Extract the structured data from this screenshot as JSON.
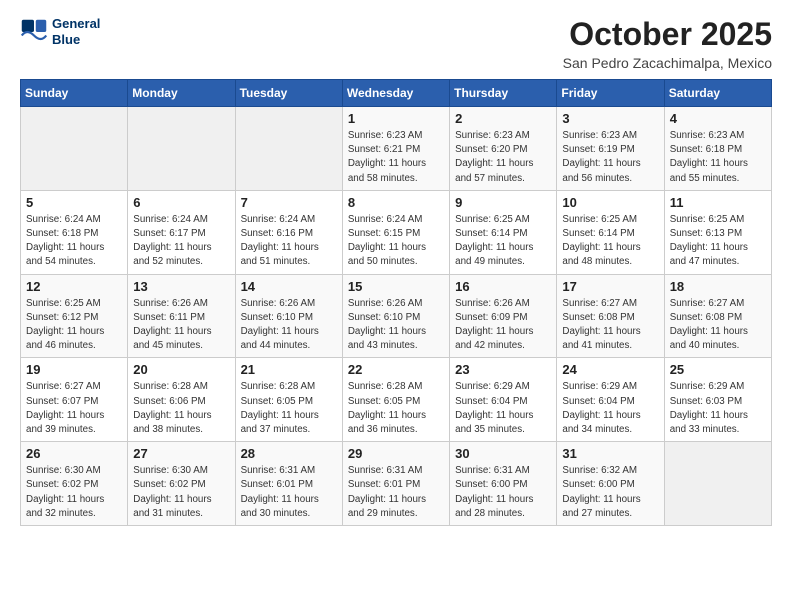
{
  "header": {
    "logo_line1": "General",
    "logo_line2": "Blue",
    "month": "October 2025",
    "location": "San Pedro Zacachimalpa, Mexico"
  },
  "weekdays": [
    "Sunday",
    "Monday",
    "Tuesday",
    "Wednesday",
    "Thursday",
    "Friday",
    "Saturday"
  ],
  "weeks": [
    [
      {
        "day": "",
        "info": ""
      },
      {
        "day": "",
        "info": ""
      },
      {
        "day": "",
        "info": ""
      },
      {
        "day": "1",
        "info": "Sunrise: 6:23 AM\nSunset: 6:21 PM\nDaylight: 11 hours\nand 58 minutes."
      },
      {
        "day": "2",
        "info": "Sunrise: 6:23 AM\nSunset: 6:20 PM\nDaylight: 11 hours\nand 57 minutes."
      },
      {
        "day": "3",
        "info": "Sunrise: 6:23 AM\nSunset: 6:19 PM\nDaylight: 11 hours\nand 56 minutes."
      },
      {
        "day": "4",
        "info": "Sunrise: 6:23 AM\nSunset: 6:18 PM\nDaylight: 11 hours\nand 55 minutes."
      }
    ],
    [
      {
        "day": "5",
        "info": "Sunrise: 6:24 AM\nSunset: 6:18 PM\nDaylight: 11 hours\nand 54 minutes."
      },
      {
        "day": "6",
        "info": "Sunrise: 6:24 AM\nSunset: 6:17 PM\nDaylight: 11 hours\nand 52 minutes."
      },
      {
        "day": "7",
        "info": "Sunrise: 6:24 AM\nSunset: 6:16 PM\nDaylight: 11 hours\nand 51 minutes."
      },
      {
        "day": "8",
        "info": "Sunrise: 6:24 AM\nSunset: 6:15 PM\nDaylight: 11 hours\nand 50 minutes."
      },
      {
        "day": "9",
        "info": "Sunrise: 6:25 AM\nSunset: 6:14 PM\nDaylight: 11 hours\nand 49 minutes."
      },
      {
        "day": "10",
        "info": "Sunrise: 6:25 AM\nSunset: 6:14 PM\nDaylight: 11 hours\nand 48 minutes."
      },
      {
        "day": "11",
        "info": "Sunrise: 6:25 AM\nSunset: 6:13 PM\nDaylight: 11 hours\nand 47 minutes."
      }
    ],
    [
      {
        "day": "12",
        "info": "Sunrise: 6:25 AM\nSunset: 6:12 PM\nDaylight: 11 hours\nand 46 minutes."
      },
      {
        "day": "13",
        "info": "Sunrise: 6:26 AM\nSunset: 6:11 PM\nDaylight: 11 hours\nand 45 minutes."
      },
      {
        "day": "14",
        "info": "Sunrise: 6:26 AM\nSunset: 6:10 PM\nDaylight: 11 hours\nand 44 minutes."
      },
      {
        "day": "15",
        "info": "Sunrise: 6:26 AM\nSunset: 6:10 PM\nDaylight: 11 hours\nand 43 minutes."
      },
      {
        "day": "16",
        "info": "Sunrise: 6:26 AM\nSunset: 6:09 PM\nDaylight: 11 hours\nand 42 minutes."
      },
      {
        "day": "17",
        "info": "Sunrise: 6:27 AM\nSunset: 6:08 PM\nDaylight: 11 hours\nand 41 minutes."
      },
      {
        "day": "18",
        "info": "Sunrise: 6:27 AM\nSunset: 6:08 PM\nDaylight: 11 hours\nand 40 minutes."
      }
    ],
    [
      {
        "day": "19",
        "info": "Sunrise: 6:27 AM\nSunset: 6:07 PM\nDaylight: 11 hours\nand 39 minutes."
      },
      {
        "day": "20",
        "info": "Sunrise: 6:28 AM\nSunset: 6:06 PM\nDaylight: 11 hours\nand 38 minutes."
      },
      {
        "day": "21",
        "info": "Sunrise: 6:28 AM\nSunset: 6:05 PM\nDaylight: 11 hours\nand 37 minutes."
      },
      {
        "day": "22",
        "info": "Sunrise: 6:28 AM\nSunset: 6:05 PM\nDaylight: 11 hours\nand 36 minutes."
      },
      {
        "day": "23",
        "info": "Sunrise: 6:29 AM\nSunset: 6:04 PM\nDaylight: 11 hours\nand 35 minutes."
      },
      {
        "day": "24",
        "info": "Sunrise: 6:29 AM\nSunset: 6:04 PM\nDaylight: 11 hours\nand 34 minutes."
      },
      {
        "day": "25",
        "info": "Sunrise: 6:29 AM\nSunset: 6:03 PM\nDaylight: 11 hours\nand 33 minutes."
      }
    ],
    [
      {
        "day": "26",
        "info": "Sunrise: 6:30 AM\nSunset: 6:02 PM\nDaylight: 11 hours\nand 32 minutes."
      },
      {
        "day": "27",
        "info": "Sunrise: 6:30 AM\nSunset: 6:02 PM\nDaylight: 11 hours\nand 31 minutes."
      },
      {
        "day": "28",
        "info": "Sunrise: 6:31 AM\nSunset: 6:01 PM\nDaylight: 11 hours\nand 30 minutes."
      },
      {
        "day": "29",
        "info": "Sunrise: 6:31 AM\nSunset: 6:01 PM\nDaylight: 11 hours\nand 29 minutes."
      },
      {
        "day": "30",
        "info": "Sunrise: 6:31 AM\nSunset: 6:00 PM\nDaylight: 11 hours\nand 28 minutes."
      },
      {
        "day": "31",
        "info": "Sunrise: 6:32 AM\nSunset: 6:00 PM\nDaylight: 11 hours\nand 27 minutes."
      },
      {
        "day": "",
        "info": ""
      }
    ]
  ]
}
